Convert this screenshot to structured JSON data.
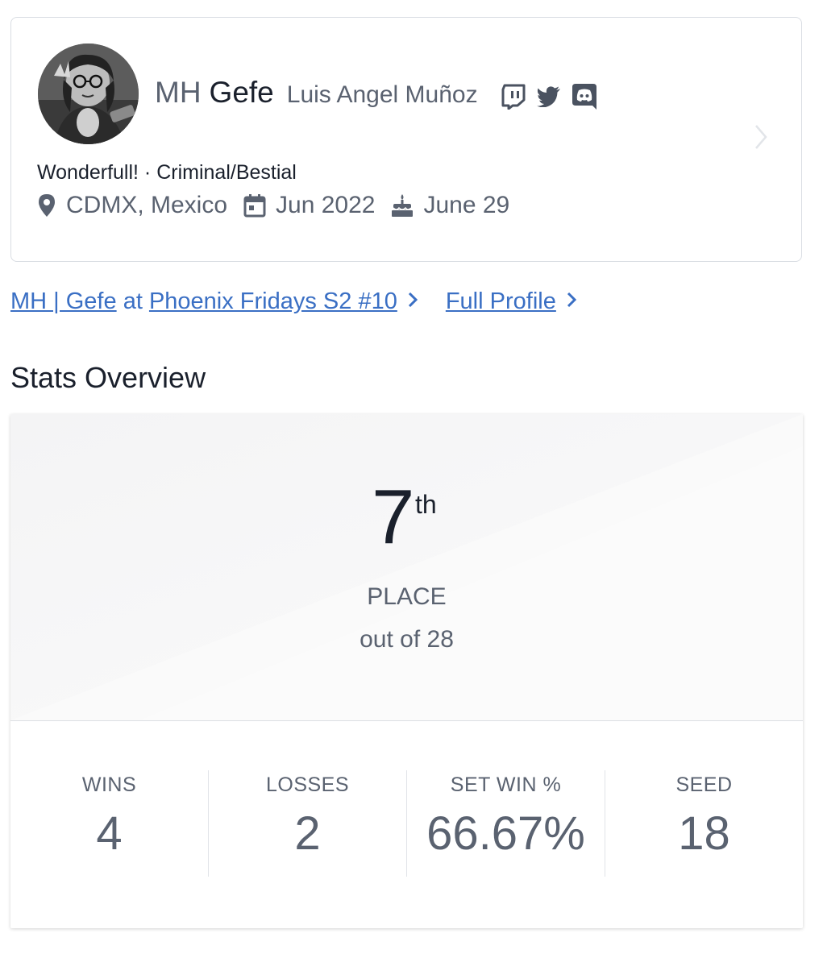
{
  "profile": {
    "prefix": "MH",
    "gamertag": "Gefe",
    "real_name": "Luis Angel Muñoz",
    "socials": [
      "twitch-icon",
      "twitter-icon",
      "discord-icon"
    ],
    "tagline": "Wonderfull! · Criminal/Bestial",
    "location": "CDMX, Mexico",
    "joined": "Jun 2022",
    "birthday": "June 29"
  },
  "links": {
    "event_player": "MH | Gefe",
    "event_at": "at",
    "event_name": "Phoenix Fridays S2 #10",
    "full_profile": "Full Profile"
  },
  "stats": {
    "heading": "Stats Overview",
    "placement": "7",
    "placement_suffix": "th",
    "placement_label": "PLACE",
    "placement_total": "out of 28",
    "items": [
      {
        "label": "WINS",
        "value": "4"
      },
      {
        "label": "LOSSES",
        "value": "2"
      },
      {
        "label": "SET WIN %",
        "value": "66.67%"
      },
      {
        "label": "SEED",
        "value": "18"
      }
    ]
  },
  "colors": {
    "link": "#3a6fc4",
    "muted_text": "#5a6270",
    "primary_text": "#1a202c",
    "border": "#d9dde3"
  }
}
